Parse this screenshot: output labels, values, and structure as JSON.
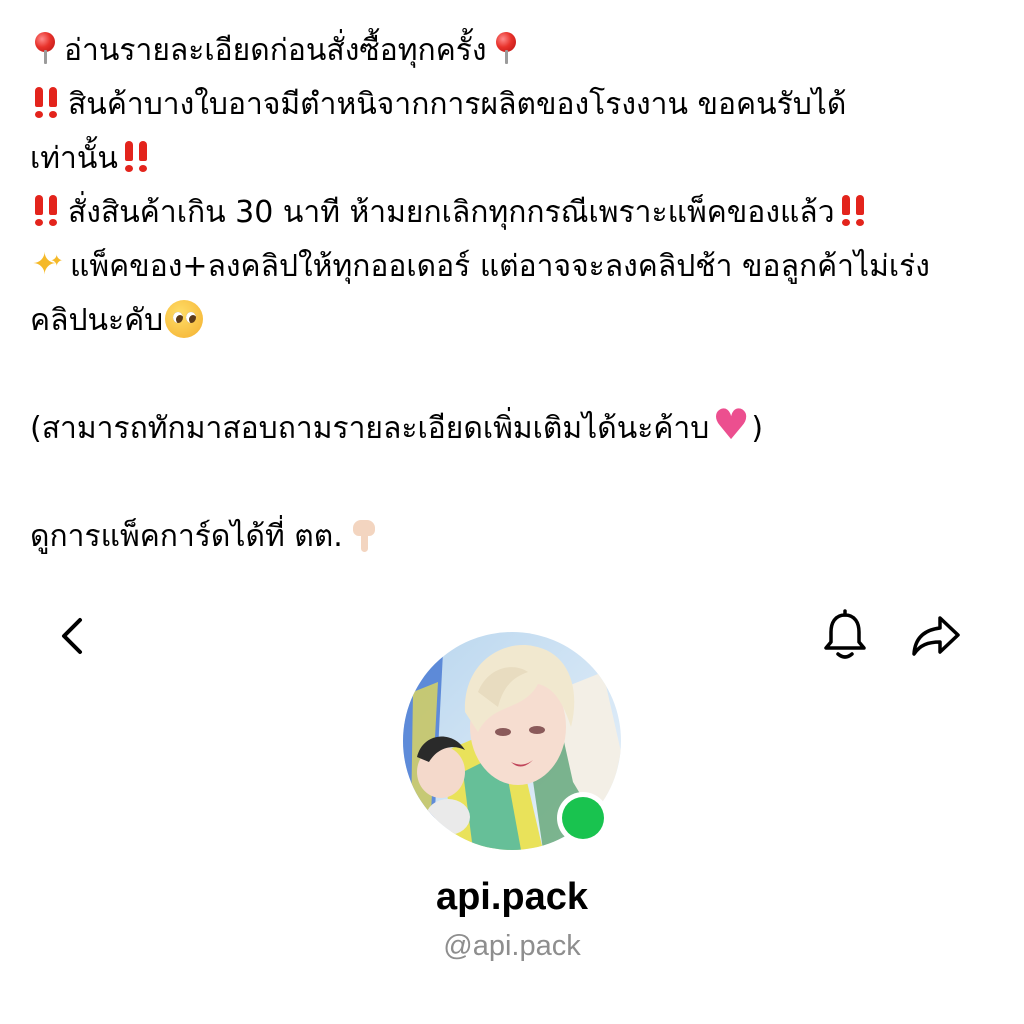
{
  "notes": {
    "line1": "อ่านรายละเอียดก่อนสั่งซื้อทุกครั้ง",
    "line2": "สินค้าบางใบอาจมีตำหนิจากการผลิตของโรงงาน ขอคนรับได้",
    "line3": "เท่านั้น",
    "line4": "สั่งสินค้าเกิน 30 นาที ห้ามยกเลิกทุกกรณีเพราะแพ็คของแล้ว",
    "line5": "แพ็คของ+ลงคลิปให้ทุกออเดอร์ แต่อาจจะลงคลิปช้า ขอลูกค้าไม่เร่ง",
    "line6": "คลิปนะคับ",
    "line7_open": "(สามารถทักมาสอบถามรายละเอียดเพิ่มเติมได้นะค้าบ",
    "line7_close": ")",
    "line8": "ดูการแพ็คการ์ดได้ที่ ตต."
  },
  "icons": {
    "pin": "round-pushpin-emoji",
    "double_exclamation": "double-exclamation-emoji",
    "sparkles": "sparkles-emoji",
    "pleading_face": "pleading-face-emoji",
    "growing_heart": "growing-heart-emoji",
    "pointing_down": "backhand-index-pointing-down-emoji",
    "back": "chevron-left-icon",
    "notifications": "bell-icon",
    "share": "share-arrow-icon"
  },
  "profile": {
    "display_name": "api.pack",
    "handle": "@api.pack",
    "online": true
  },
  "colors": {
    "background": "#ffffff",
    "text": "#000000",
    "handle_gray": "#8e8e8e",
    "online_green": "#19c34f",
    "emoji_red": "#e3241c"
  }
}
